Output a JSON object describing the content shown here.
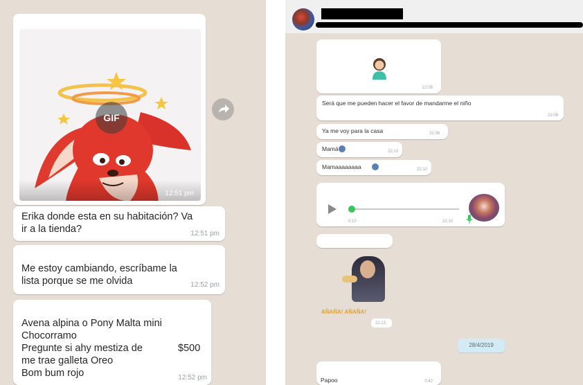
{
  "left_chat": {
    "gif_badge": "GIF",
    "gif_time": "12:51 pm",
    "messages": [
      {
        "lines": "Erika donde esta en su habitación? Va\nir a la tienda?",
        "time": "12:51 pm"
      },
      {
        "lines": "Me estoy cambiando, escríbame la\nlista porque se me olvida",
        "time": "12:52 pm"
      },
      {
        "lines": "Avena alpina o Pony Malta mini\nChocorramo\nPregunte si ahy mestiza de\nme trae galleta Oreo\nBom bum rojo",
        "price": "$500",
        "time": "12:52 pm"
      }
    ]
  },
  "right_chat": {
    "header": {
      "name": "",
      "status": ""
    },
    "sticker_time": "22:08",
    "messages": [
      {
        "text": "Será que me pueden hacer el favor de mandarme el niño",
        "time": "22:08"
      },
      {
        "text": "Ya me voy para la casa",
        "time": "22:08"
      },
      {
        "text": "Mamá",
        "time": "22:10"
      },
      {
        "text": "Mamaaaaaaaa",
        "time": "22:10"
      }
    ],
    "voice": {
      "elapsed": "0:10",
      "time": "22:10"
    },
    "photo_caption": "AÑAÑA! AÑAÑA!",
    "photo_time": "22:13",
    "date_chip": "28/4/2019",
    "last_message": {
      "text": "Papoo",
      "time": "0:42"
    }
  },
  "colors": {
    "chat_bg": "#e6ddd4",
    "bubble": "#ffffff",
    "date_chip": "#d4eaf4",
    "voice_accent": "#34c759",
    "sticker_red": "#d8322a"
  }
}
